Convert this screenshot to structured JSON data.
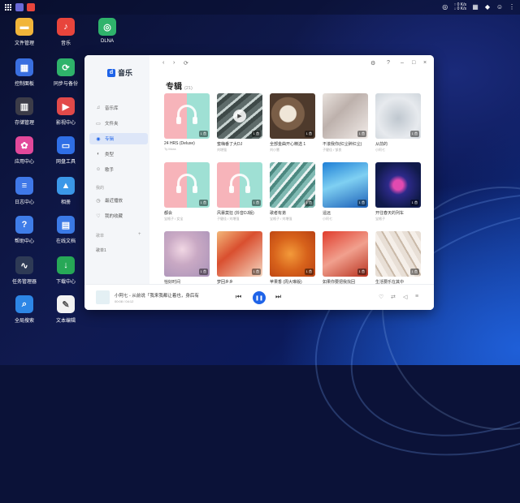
{
  "topbar": {
    "speed_up": "↑ 0 K/s",
    "speed_down": "↓ 0 K/s"
  },
  "desktop": {
    "icons": [
      {
        "name": "desktop-icon-file-manager",
        "label": "文件管理",
        "color": "#f1b53a",
        "glyph": "▬"
      },
      {
        "name": "desktop-icon-music",
        "label": "音乐",
        "color": "#e8453c",
        "glyph": "♪"
      },
      {
        "name": "desktop-icon-dlna",
        "label": "DLNA",
        "color": "#2fb36b",
        "glyph": "◎"
      },
      {
        "name": "desktop-icon-control-panel",
        "label": "控制面板",
        "color": "#3a6fe0",
        "glyph": "▦"
      },
      {
        "name": "desktop-icon-sync-backup",
        "label": "同步与备份",
        "color": "#2fb36b",
        "glyph": "⟳"
      },
      {
        "name": "desktop-icon-storage",
        "label": "存储管理",
        "color": "#3c3c48",
        "glyph": "▥"
      },
      {
        "name": "desktop-icon-video-center",
        "label": "影视中心",
        "color": "#e24a4a",
        "glyph": "▶"
      },
      {
        "name": "desktop-icon-app-center",
        "label": "应用中心",
        "color": "#e2489a",
        "glyph": "✿"
      },
      {
        "name": "desktop-icon-disk-tool",
        "label": "网盘工具",
        "color": "#2f6fe6",
        "glyph": "▭"
      },
      {
        "name": "desktop-icon-log-center",
        "label": "日志中心",
        "color": "#3f78e8",
        "glyph": "≡"
      },
      {
        "name": "desktop-icon-photos",
        "label": "相册",
        "color": "#3b98e8",
        "glyph": "▲"
      },
      {
        "name": "desktop-icon-help",
        "label": "帮助中心",
        "color": "#3f7de8",
        "glyph": "?"
      },
      {
        "name": "desktop-icon-online-docs",
        "label": "在线文档",
        "color": "#3b7ae6",
        "glyph": "▤"
      },
      {
        "name": "desktop-icon-task-manager",
        "label": "任务管理器",
        "color": "#2e3a55",
        "glyph": "∿"
      },
      {
        "name": "desktop-icon-download-center",
        "label": "下载中心",
        "color": "#27a857",
        "glyph": "↓"
      },
      {
        "name": "desktop-icon-global-search",
        "label": "全局搜索",
        "color": "#2d86e6",
        "glyph": "⌕"
      },
      {
        "name": "desktop-icon-text-editor",
        "label": "文本编辑",
        "color": "#f3f3f3",
        "glyph": "✎"
      }
    ]
  },
  "app": {
    "name": "音乐",
    "logo_glyph": "d",
    "accent": "#1e63e8"
  },
  "sidebar": {
    "items": [
      {
        "name": "nav-music-library",
        "label": "音乐库",
        "icon": "♫",
        "active": false
      },
      {
        "name": "nav-folders",
        "label": "文件夹",
        "icon": "▭",
        "active": false
      },
      {
        "name": "nav-albums",
        "label": "专辑",
        "icon": "◉",
        "active": true
      },
      {
        "name": "nav-genres",
        "label": "类型",
        "icon": "◐",
        "active": false
      },
      {
        "name": "nav-artists",
        "label": "歌手",
        "icon": "☺",
        "active": false
      }
    ],
    "section_label": "我的",
    "my_items": [
      {
        "name": "nav-recently-played",
        "label": "最近播放",
        "icon": "◷"
      },
      {
        "name": "nav-favorites",
        "label": "我的收藏",
        "icon": "♡"
      }
    ],
    "playlist_section": "歌单",
    "playlist_add": "+",
    "playlists": [
      {
        "label": "歌单1"
      }
    ]
  },
  "main": {
    "title": "专辑",
    "count": "(21)"
  },
  "albums": [
    {
      "name": "24 HRS (Deluxe)",
      "artist": "Ty Mora",
      "badge": "1 首",
      "bg": "linear-gradient(90deg,#f7b4ba 0 50%,#9fe0d4 50%)",
      "headphones": true
    },
    {
      "name": "蜜嗨番了大DJ",
      "artist": "刘增强",
      "badge": "1 首",
      "bg": "repeating-linear-gradient(140deg,#5e6b6a 0 6px,#c9d4d2 6px 9px,#3e4948 9px 14px)",
      "play": true
    },
    {
      "name": "全部金曲开心精选 1",
      "artist": "刘小慧",
      "badge": "1 首",
      "bg": "radial-gradient(circle at 40% 45%,#efe6d8 0 10px,#7a5e47 11px 20px,#4e3a2c 21px)"
    },
    {
      "name": "不滚我你(红尘醉红尘)",
      "artist": "子健佳 / 邹良",
      "badge": "1 首",
      "bg": "linear-gradient(135deg,#e9e2dd 0%,#bdb1ac 40%,#f2ece9 100%)"
    },
    {
      "name": "从前的",
      "artist": "小阿七",
      "badge": "1 首",
      "bg": "radial-gradient(circle at 50% 55%,#bfc7cf 0,#e7eaee 60%,#cfd6dc 100%)"
    },
    {
      "name": "都会",
      "artist": "宝格子 / 女宝",
      "badge": "1 首",
      "bg": "linear-gradient(90deg,#f7b4ba 0 50%,#9fe0d4 50%)",
      "headphones": true
    },
    {
      "name": "风暴莫狂 (抖音DJ版)",
      "artist": "子健佳 / 刘增强",
      "badge": "1 首",
      "bg": "linear-gradient(90deg,#f7b4ba 0 50%,#9fe0d4 50%)",
      "headphones": true
    },
    {
      "name": "歌者有弟",
      "artist": "宝格子 / 刘增强",
      "badge": "1 首",
      "bg": "repeating-linear-gradient(130deg,#7fb9b2 0 5px,#e9f2f1 5px 8px,#4c8880 8px 12px)"
    },
    {
      "name": "遥远",
      "artist": "小阿七",
      "badge": "1 首",
      "bg": "linear-gradient(160deg,#1e7fd6 0%,#7fd0f2 45%,#1b5fb8 100%)"
    },
    {
      "name": "开往春天的列车",
      "artist": "宝格子",
      "badge": "1 首",
      "bg": "radial-gradient(circle at 50% 50%,#e24ab0 0 6px,#2d2a8a 12px,#101a4a 30px)"
    },
    {
      "name": "恰好时间",
      "artist": "小阿七 / 刘增",
      "badge": "1 首",
      "bg": "radial-gradient(circle at 40% 40%,#f1d7e4 0,#c9a9c4 40%,#a892b8 100%)"
    },
    {
      "name": "梦回乡乡",
      "artist": "宝格子",
      "badge": "1 首",
      "bg": "linear-gradient(140deg,#f3b87a 0%,#d94f2f 40%,#f6d8c2 100%)"
    },
    {
      "name": "苹果香 (周大琳版)",
      "artist": "宝格子 / 小阿七",
      "badge": "1 首",
      "bg": "radial-gradient(circle at 45% 50%,#f39a3a 0,#d7621b 50%,#b94112 100%)"
    },
    {
      "name": "如果你要把我找回",
      "artist": "宝格子",
      "badge": "1 首",
      "bg": "linear-gradient(150deg,#e03c2c 0%,#f1a08e 50%,#b8321f 100%)"
    },
    {
      "name": "生活要乐在其中",
      "artist": "宝格子 / 刘增",
      "badge": "1 首",
      "bg": "repeating-linear-gradient(60deg,#e8dfd6 0 6px,#c9b9a8 6px 8px,#f5efe9 8px 14px)"
    }
  ],
  "player": {
    "track": "小阿七 - 从前说「我来我都让着也，身后有",
    "time": "00:08 / 04:12"
  }
}
